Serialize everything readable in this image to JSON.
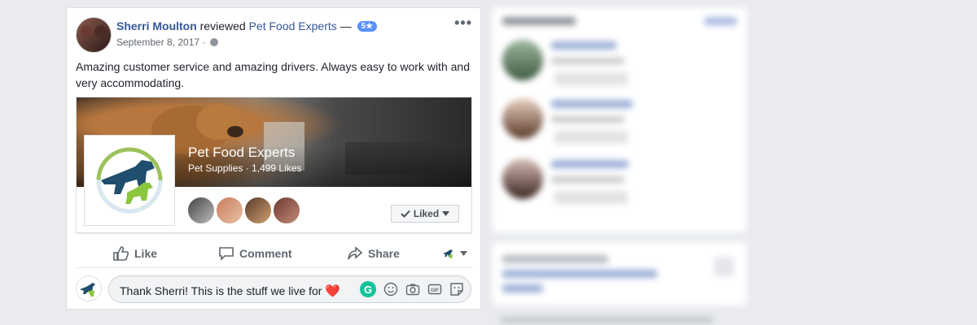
{
  "post": {
    "author": "Sherri Moulton",
    "verb": "reviewed",
    "page": "Pet Food Experts",
    "dash": "—",
    "rating": "5★",
    "date": "September 8, 2017",
    "dot": "·",
    "more": "•••",
    "text": "Amazing customer service and amazing drivers. Always easy to work with and very accommodating."
  },
  "page_card": {
    "name": "Pet Food Experts",
    "meta": "Pet Supplies · 1,499 Likes",
    "liked_label": "Liked"
  },
  "actions": {
    "like": "Like",
    "comment": "Comment",
    "share": "Share"
  },
  "comment": {
    "text": "Thank Sherri! This is the stuff we live for",
    "heart": "❤️",
    "grammarly": "G"
  },
  "icons": [
    "globe-icon",
    "more-icon",
    "like-icon",
    "comment-icon",
    "share-icon",
    "emoji-icon",
    "camera-icon",
    "gif-icon",
    "sticker-icon",
    "chevron-down-icon",
    "checkmark-icon"
  ],
  "colors": {
    "link": "#365899",
    "rating": "#5890ff",
    "grammarly": "#15c39a",
    "heart": "#e0393e",
    "background": "#e9ebee"
  }
}
